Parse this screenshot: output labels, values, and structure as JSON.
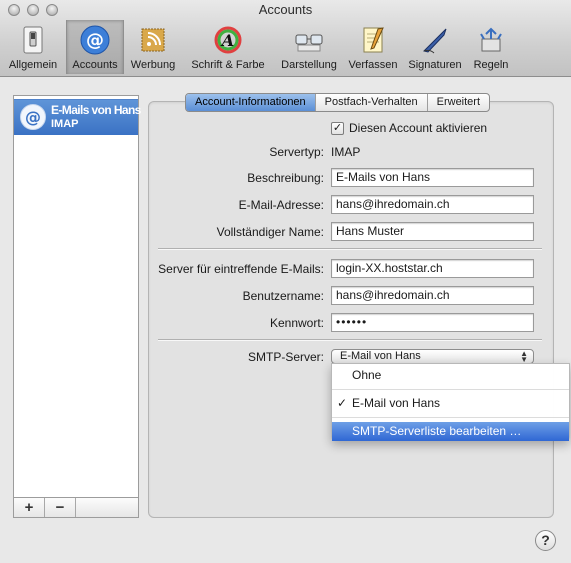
{
  "window": {
    "title": "Accounts"
  },
  "toolbar": {
    "items": [
      {
        "label": "Allgemein",
        "icon": "switch-icon"
      },
      {
        "label": "Accounts",
        "icon": "at-sign-icon",
        "selected": true
      },
      {
        "label": "Werbung",
        "icon": "rss-stamp-icon"
      },
      {
        "label": "Schrift & Farbe",
        "icon": "font-color-icon"
      },
      {
        "label": "Darstellung",
        "icon": "glasses-icon"
      },
      {
        "label": "Verfassen",
        "icon": "notepad-pencil-icon"
      },
      {
        "label": "Signaturen",
        "icon": "pen-nib-icon"
      },
      {
        "label": "Regeln",
        "icon": "rules-arrows-icon"
      }
    ]
  },
  "sidebar": {
    "accounts": [
      {
        "name": "E-Mails von Hans",
        "type": "IMAP",
        "selected": true
      }
    ],
    "add_label": "+",
    "remove_label": "−"
  },
  "tabs": [
    {
      "label": "Account-Informationen",
      "active": true
    },
    {
      "label": "Postfach-Verhalten"
    },
    {
      "label": "Erweitert"
    }
  ],
  "form": {
    "enable": {
      "label": "Diesen Account aktivieren",
      "checked": true,
      "mark": "✓"
    },
    "server_type": {
      "label": "Servertyp:",
      "value": "IMAP"
    },
    "description": {
      "label": "Beschreibung:",
      "value": "E-Mails von Hans"
    },
    "email": {
      "label": "E-Mail-Adresse:",
      "value": "hans@ihredomain.ch"
    },
    "full_name": {
      "label": "Vollständiger Name:",
      "value": "Hans Muster"
    },
    "incoming_server": {
      "label": "Server für eintreffende E-Mails:",
      "value": "login-XX.hoststar.ch"
    },
    "username": {
      "label": "Benutzername:",
      "value": "hans@ihredomain.ch"
    },
    "password": {
      "label": "Kennwort:",
      "value": "••••••"
    },
    "smtp": {
      "label": "SMTP-Server:",
      "value": "E-Mail von Hans"
    }
  },
  "smtp_menu": {
    "items": [
      {
        "label": "Ohne"
      },
      {
        "label": "E-Mail von Hans",
        "checked": true,
        "mark": "✓"
      },
      {
        "label": "SMTP-Serverliste bearbeiten …",
        "highlighted": true
      }
    ]
  },
  "help_label": "?",
  "colors": {
    "selection": "#3a72c4",
    "menu_highlight": "#2f67d4"
  }
}
